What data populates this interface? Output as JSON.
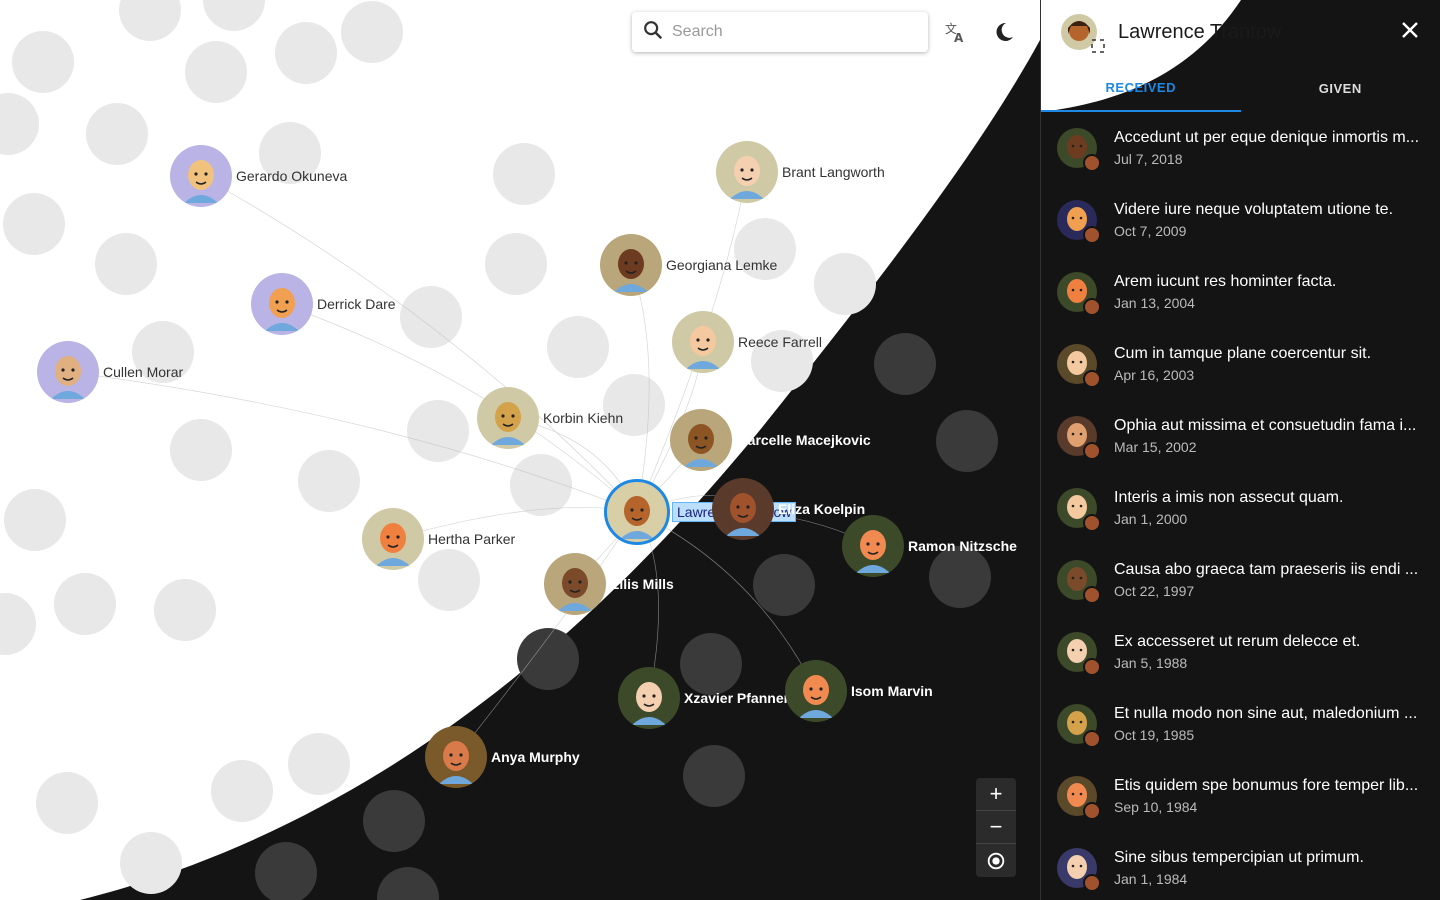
{
  "search": {
    "placeholder": "Search"
  },
  "toolbar": {
    "translate_icon": "translate-icon",
    "theme_icon": "dark-mode-icon"
  },
  "zoom": {
    "in_label": "+",
    "out_label": "−",
    "center_icon": "center-focus-icon"
  },
  "colors": {
    "accent": "#1e88e5",
    "dark_bg": "#141414"
  },
  "graph": {
    "nodes": [
      {
        "name": "Gerardo Okuneva",
        "skin": "#f1c27d",
        "bg": "#b9b3e6",
        "theme": "light"
      },
      {
        "name": "Brant Langworth",
        "skin": "#f5d0b0",
        "bg": "#cfc9a6",
        "theme": "light"
      },
      {
        "name": "Georgiana Lemke",
        "skin": "#6d3b1f",
        "bg": "#b9a67a",
        "theme": "light"
      },
      {
        "name": "Derrick Dare",
        "skin": "#f0a050",
        "bg": "#b9b3e6",
        "theme": "light"
      },
      {
        "name": "Reece Farrell",
        "skin": "#f5c9a0",
        "bg": "#cfc9a6",
        "theme": "light"
      },
      {
        "name": "Cullen Morar",
        "skin": "#e0b080",
        "bg": "#b9b3e6",
        "theme": "light"
      },
      {
        "name": "Korbin Kiehn",
        "skin": "#d4a24a",
        "bg": "#cfc9a6",
        "theme": "light"
      },
      {
        "name": "Marcelle Macejkovic",
        "skin": "#8d5524",
        "bg": "#b9a67a",
        "theme": "dark"
      },
      {
        "name": "Lawrence Trantow",
        "skin": "#b5652b",
        "bg": "#d9cfa6",
        "theme": "focus"
      },
      {
        "name": "Eliza Koelpin",
        "skin": "#a0522d",
        "bg": "#5a3a2a",
        "theme": "dark"
      },
      {
        "name": "Hertha Parker",
        "skin": "#f08040",
        "bg": "#cfc9a6",
        "theme": "light"
      },
      {
        "name": "Ramon Nitzsche",
        "skin": "#f08a50",
        "bg": "#3d4a2a",
        "theme": "dark"
      },
      {
        "name": "Ellis Mills",
        "skin": "#7a4a2a",
        "bg": "#b9a67a",
        "theme": "dark"
      },
      {
        "name": "Xzavier Pfannerstill",
        "skin": "#f5d0b0",
        "bg": "#3d4a2a",
        "theme": "dark"
      },
      {
        "name": "Isom Marvin",
        "skin": "#f08a50",
        "bg": "#3d4a2a",
        "theme": "dark"
      },
      {
        "name": "Anya Murphy",
        "skin": "#d87a4a",
        "bg": "#7a5a2a",
        "theme": "dark"
      }
    ]
  },
  "panel": {
    "title": "Lawrence Trantow",
    "tabs": [
      {
        "label": "RECEIVED",
        "active": true
      },
      {
        "label": "GIVEN",
        "active": false
      }
    ],
    "items": [
      {
        "text": "Accedunt ut per eque denique inmortis m...",
        "date": "Jul 7, 2018",
        "skin": "#6d3b1f",
        "bg": "#3d4a2a"
      },
      {
        "text": "Videre iure neque voluptatem utione te.",
        "date": "Oct 7, 2009",
        "skin": "#f0a050",
        "bg": "#2a2a5a"
      },
      {
        "text": "Arem iucunt res hominter facta.",
        "date": "Jan 13, 2004",
        "skin": "#f08040",
        "bg": "#3d4a2a"
      },
      {
        "text": "Cum in tamque plane coercentur sit.",
        "date": "Apr 16, 2003",
        "skin": "#f5c9a0",
        "bg": "#5a4a2a"
      },
      {
        "text": "Ophia aut missima et consuetudin fama i...",
        "date": "Mar 15, 2002",
        "skin": "#e0a070",
        "bg": "#5a3a2a"
      },
      {
        "text": "Interis a imis non assecut quam.",
        "date": "Jan 1, 2000",
        "skin": "#f5c9a0",
        "bg": "#3d4a2a"
      },
      {
        "text": "Causa abo graeca tam praeseris iis endi ...",
        "date": "Oct 22, 1997",
        "skin": "#7a4a2a",
        "bg": "#3d4a2a"
      },
      {
        "text": "Ex accesseret ut rerum delecce et.",
        "date": "Jan 5, 1988",
        "skin": "#f5d0b0",
        "bg": "#3d4a2a"
      },
      {
        "text": "Et nulla modo non sine aut, maledonium ...",
        "date": "Oct 19, 1985",
        "skin": "#d4a24a",
        "bg": "#3d4a2a"
      },
      {
        "text": "Etis quidem spe bonumus fore temper lib...",
        "date": "Sep 10, 1984",
        "skin": "#f08a50",
        "bg": "#5a4a2a"
      },
      {
        "text": "Sine sibus tempercipian ut primum.",
        "date": "Jan 1, 1984",
        "skin": "#f5d0b0",
        "bg": "#3a3a6a"
      }
    ]
  }
}
